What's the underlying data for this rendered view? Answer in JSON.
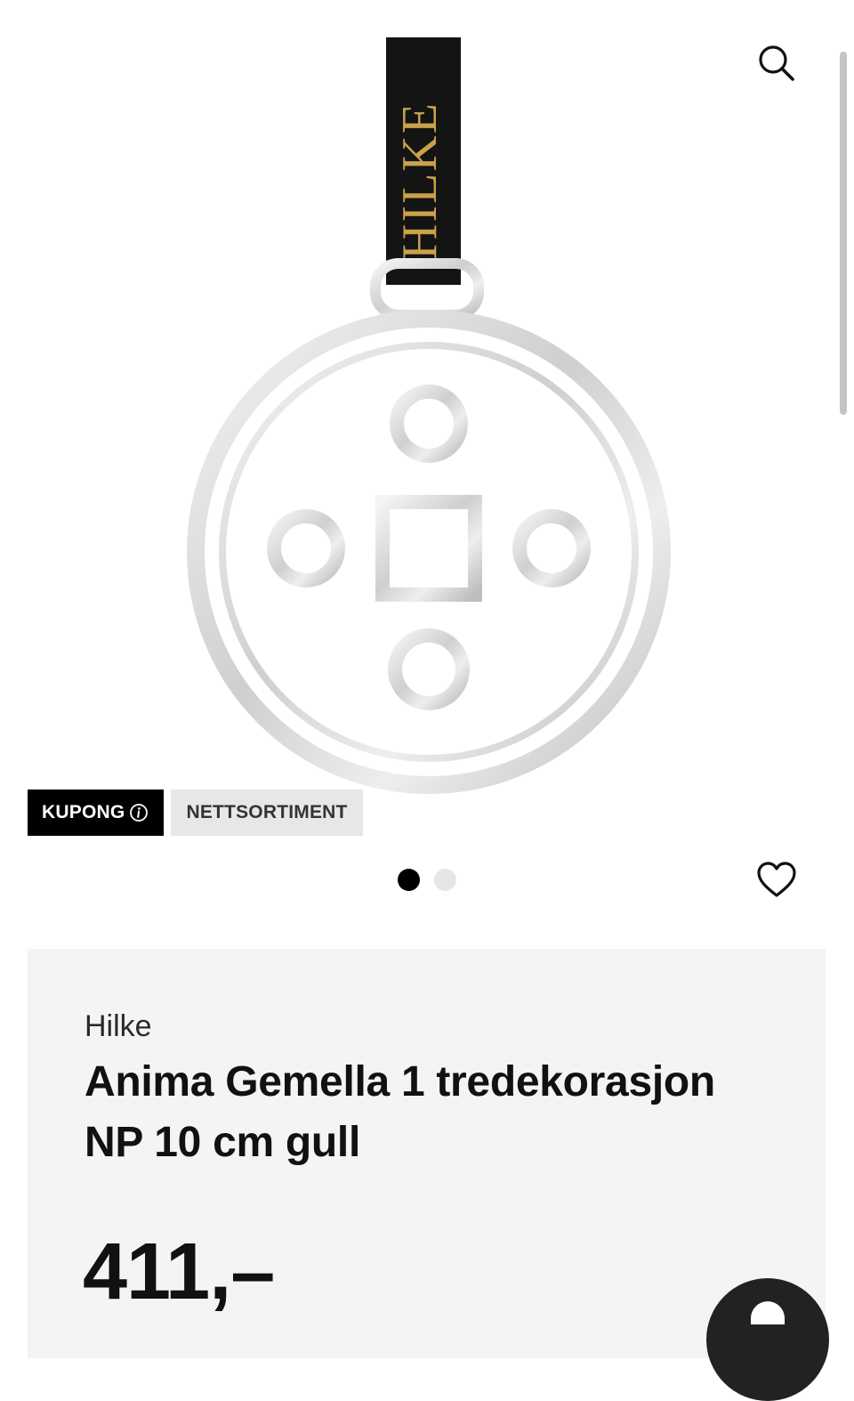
{
  "product": {
    "image_alt": "Hilke Anima Gemella ornament",
    "tag_text": "HILKE",
    "brand": "Hilke",
    "title": "Anima Gemella 1 tredekorasjon NP 10 cm gull",
    "price": "411,–"
  },
  "badges": {
    "coupon": "KUPONG",
    "web_only": "NETTSORTIMENT"
  },
  "carousel": {
    "count": 2,
    "active_index": 0
  },
  "icons": {
    "search": "search-icon",
    "favorite": "heart-icon",
    "info": "info-icon",
    "chat": "chat-icon"
  },
  "colors": {
    "badge_coupon_bg": "#000000",
    "badge_web_bg": "#e7e7e7",
    "panel_bg": "#f4f4f4",
    "tag_text": "#c9a24a"
  }
}
